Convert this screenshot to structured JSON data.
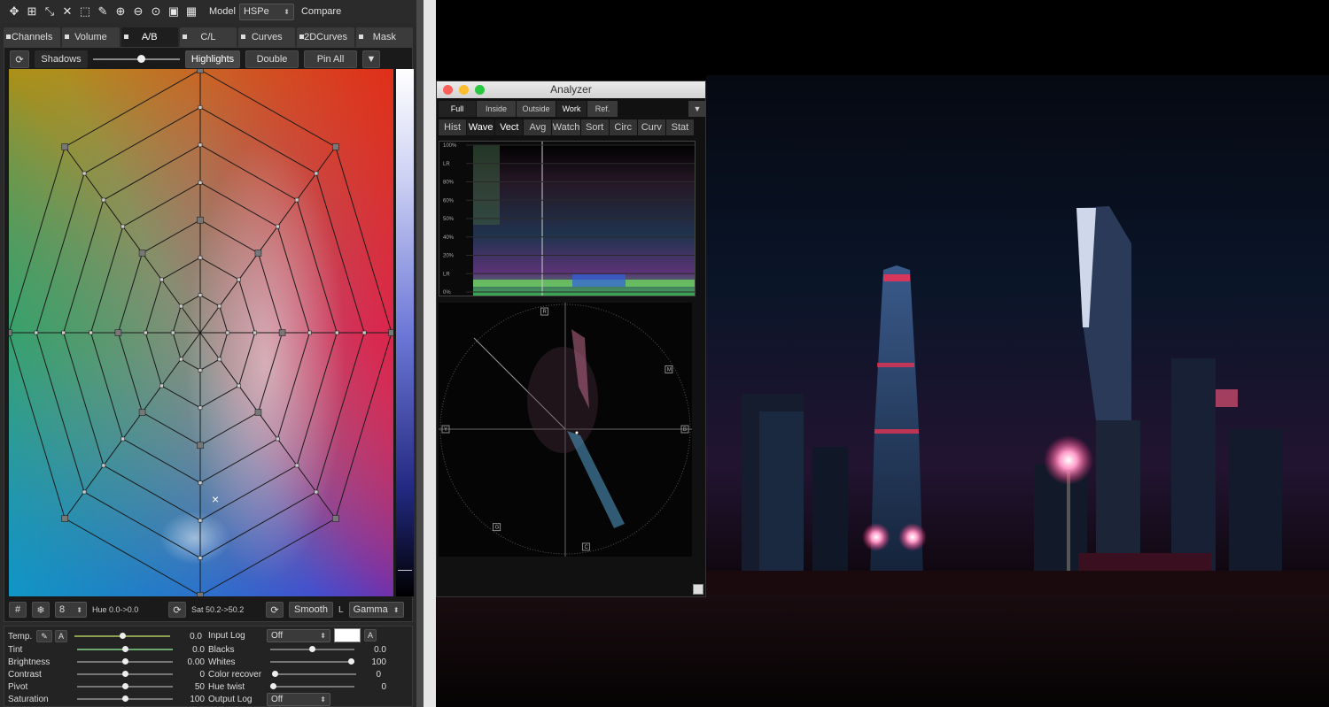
{
  "toolbar": {
    "icons": [
      "move-icon",
      "grid-add-icon",
      "shrink-icon",
      "expand-icon",
      "marquee-icon",
      "eyedropper-icon",
      "zoom-in-icon",
      "zoom-out-icon",
      "zoom-fit-icon",
      "frame-icon",
      "grid-icon"
    ],
    "model_label": "Model",
    "model_value": "HSPe",
    "compare_label": "Compare"
  },
  "tabs": [
    {
      "label": "Channels"
    },
    {
      "label": "Volume"
    },
    {
      "label": "A/B"
    },
    {
      "label": "C/L"
    },
    {
      "label": "Curves"
    },
    {
      "label": "2DCurves"
    },
    {
      "label": "Mask"
    }
  ],
  "controls": {
    "shadows": "Shadows",
    "highlights": "Highlights",
    "double": "Double",
    "pin_all": "Pin All",
    "shadows_highlights_balance": 0.55
  },
  "grid_bottom": {
    "count": "8",
    "hue": "Hue 0.0->0.0",
    "sat": "Sat 50.2->50.2",
    "smooth": "Smooth",
    "l_label": "L",
    "gamma": "Gamma"
  },
  "params_left": [
    {
      "label": "Temp.",
      "value": "0.0",
      "pos": 0.5
    },
    {
      "label": "Tint",
      "value": "0.0",
      "pos": 0.5
    },
    {
      "label": "Brightness",
      "value": "0.00",
      "pos": 0.5
    },
    {
      "label": "Contrast",
      "value": "0",
      "pos": 0.5
    },
    {
      "label": "Pivot",
      "value": "50",
      "pos": 0.5
    },
    {
      "label": "Saturation",
      "value": "100",
      "pos": 0.5
    }
  ],
  "params_right": {
    "input_log_label": "Input Log",
    "input_log_value": "Off",
    "a_label": "A",
    "blacks": {
      "label": "Blacks",
      "value": "0.0",
      "pos": 0.5
    },
    "whites": {
      "label": "Whites",
      "value": "100",
      "pos": 1.0
    },
    "color_recover": {
      "label": "Color recover",
      "value": "0",
      "pos": 0.0
    },
    "hue_twist": {
      "label": "Hue twist",
      "value": "0",
      "pos": 0.0
    },
    "output_log_label": "Output Log",
    "output_log_value": "Off"
  },
  "analyzer": {
    "title": "Analyzer",
    "tabs": [
      "Full",
      "Inside",
      "Outside",
      "Work",
      "Ref."
    ],
    "active_tab": "Work",
    "view_tabs": [
      "Hist",
      "Wave",
      "Vect",
      "Avg",
      "Watch",
      "Sort",
      "Circ",
      "Curv",
      "Stat"
    ],
    "active_views": [
      "Wave",
      "Vect"
    ],
    "wave_scale": [
      "100%",
      "LR",
      "80%",
      "60%",
      "50%",
      "40%",
      "20%",
      "LR",
      "0%"
    ],
    "vector_targets": [
      "R",
      "M",
      "Y",
      "B",
      "G",
      "C"
    ]
  }
}
